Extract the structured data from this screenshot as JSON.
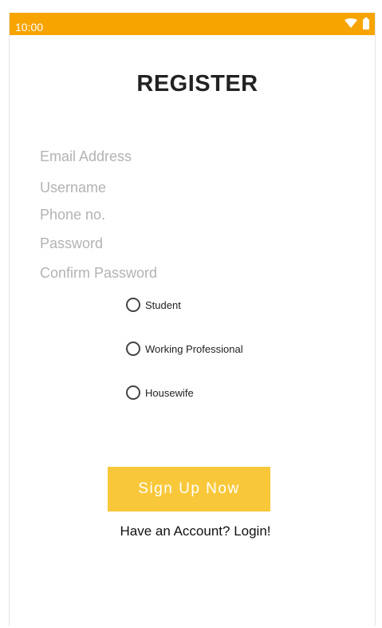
{
  "status_bar": {
    "time": "10:00",
    "icons": [
      "wifi-icon",
      "battery-icon"
    ],
    "color": "#f7a400"
  },
  "title": "REGISTER",
  "form": {
    "email_placeholder": "Email Address",
    "username_placeholder": "Username",
    "phone_placeholder": "Phone no.",
    "password_placeholder": "Password",
    "confirm_password_placeholder": "Confirm Password"
  },
  "occupation_options": [
    {
      "label": "Student",
      "selected": false
    },
    {
      "label": "Working Professional",
      "selected": false
    },
    {
      "label": "Housewife",
      "selected": false
    }
  ],
  "signup_button": {
    "label": "Sign Up Now",
    "color": "#f9c83a"
  },
  "login_link": "Have an Account? Login!"
}
